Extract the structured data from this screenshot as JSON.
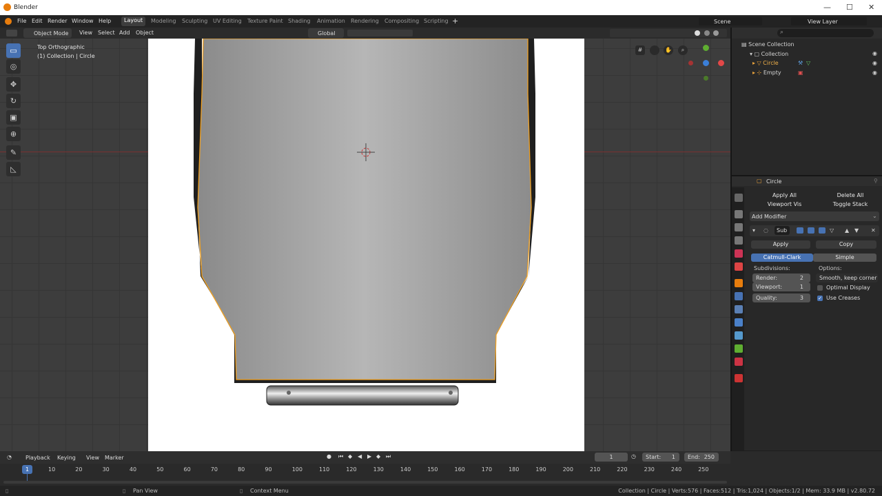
{
  "titlebar": {
    "title": "Blender",
    "minimize": "—",
    "maximize": "☐",
    "close": "✕"
  },
  "menu": {
    "items": [
      "File",
      "Edit",
      "Render",
      "Window",
      "Help"
    ],
    "workspaces": [
      "Layout",
      "Modeling",
      "Sculpting",
      "UV Editing",
      "Texture Paint",
      "Shading",
      "Animation",
      "Rendering",
      "Compositing",
      "Scripting"
    ],
    "add_workspace": "+",
    "scene": "Scene",
    "view_layer": "View Layer"
  },
  "header": {
    "mode": "Object Mode",
    "view": "View",
    "select": "Select",
    "add": "Add",
    "object": "Object",
    "orientation": "Global"
  },
  "viewport": {
    "view_name": "Top Orthographic",
    "collection_info": "(1) Collection | Circle"
  },
  "outliner": {
    "root": "Scene Collection",
    "collection": "Collection",
    "items": [
      "Circle",
      "Empty"
    ]
  },
  "properties": {
    "object_name": "Circle",
    "apply_all": "Apply All",
    "delete_all": "Delete All",
    "viewport_vis": "Viewport Vis",
    "toggle_stack": "Toggle Stack",
    "add_modifier": "Add Modifier",
    "modifier_name": "Sub",
    "apply": "Apply",
    "copy": "Copy",
    "catmull": "Catmull-Clark",
    "simple": "Simple",
    "subdivisions": "Subdivisions:",
    "options": "Options:",
    "render_label": "Render:",
    "render_value": "2",
    "viewport_label": "Viewport:",
    "viewport_value": "1",
    "quality_label": "Quality:",
    "quality_value": "3",
    "uv_smooth": "Smooth, keep corner",
    "optimal_display": "Optimal Display",
    "use_creases": "Use Creases",
    "optimal_checked": false,
    "creases_checked": true
  },
  "timeline": {
    "playback": "Playback",
    "keying": "Keying",
    "view": "View",
    "marker": "Marker",
    "current_frame": "1",
    "start_label": "Start:",
    "start": "1",
    "end_label": "End:",
    "end": "250",
    "current_marker": "1",
    "ticks": [
      "10",
      "20",
      "30",
      "40",
      "50",
      "60",
      "70",
      "80",
      "90",
      "100",
      "110",
      "120",
      "130",
      "140",
      "150",
      "160",
      "170",
      "180",
      "190",
      "200",
      "210",
      "220",
      "230",
      "240",
      "250"
    ]
  },
  "statusbar": {
    "pan": "Pan View",
    "context": "Context Menu",
    "stats": "Collection | Circle | Verts:576 | Faces:512 | Tris:1,024 | Objects:1/2 | Mem: 33.9 MB | v2.80.72"
  },
  "colors": {
    "accent": "#4772b3",
    "outline": "#e8a33a",
    "brand": "#e87d0d"
  }
}
